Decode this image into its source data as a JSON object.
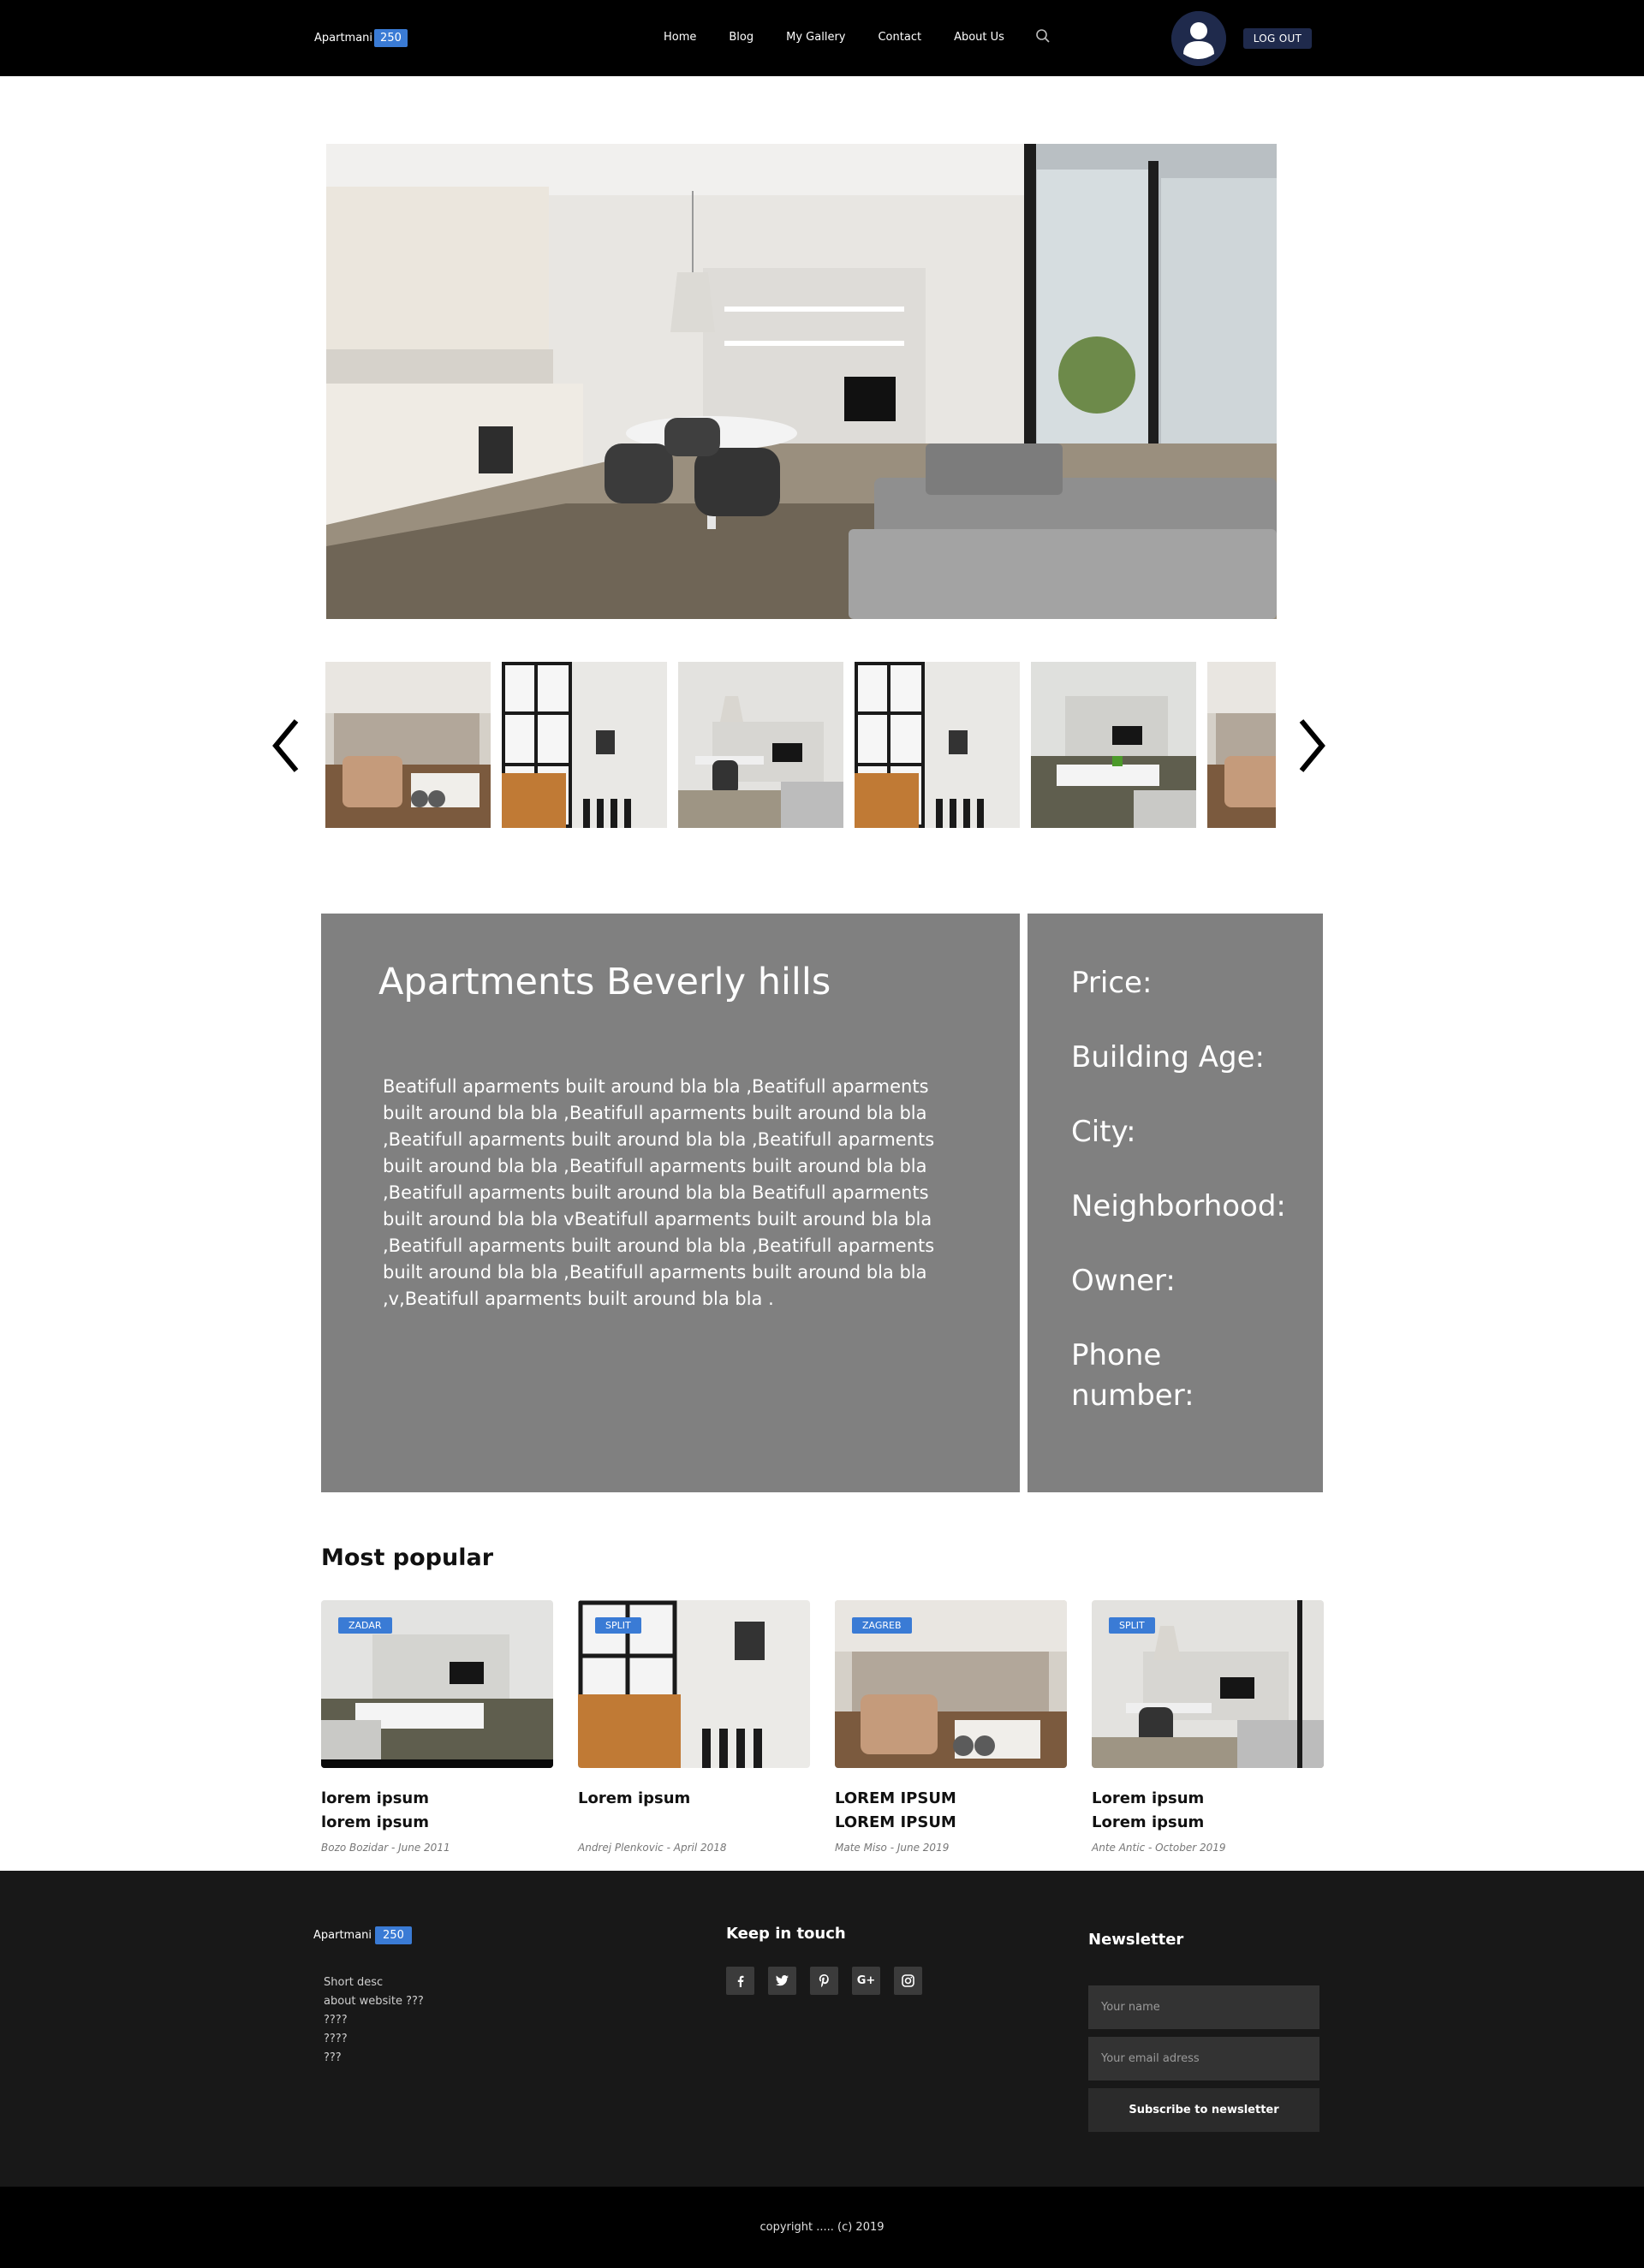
{
  "header": {
    "brand_name": "Apartmani",
    "brand_badge": "250",
    "nav": [
      "Home",
      "Blog",
      "My Gallery",
      "Contact",
      "About Us"
    ],
    "search_icon": "search-icon",
    "avatar_icon": "user-avatar-icon",
    "logout_label": "LOG OUT",
    "accent_color": "#3a7bd5",
    "navy_color": "#1f2a4c"
  },
  "gallery": {
    "prev_icon": "chevron-left-icon",
    "next_icon": "chevron-right-icon",
    "thumbnail_count": 6
  },
  "listing": {
    "title": "Apartments Beverly hills",
    "description": "Beatifull aparments built around bla bla ,Beatifull aparments built around bla bla ,Beatifull aparments built around bla bla ,Beatifull aparments built around bla bla ,Beatifull aparments built around bla bla ,Beatifull aparments built around bla bla ,Beatifull aparments built around bla bla Beatifull aparments built around bla bla vBeatifull aparments built around bla bla ,Beatifull aparments built around bla bla ,Beatifull aparments built around bla bla ,Beatifull aparments built around bla bla ,v,Beatifull aparments built around bla bla .",
    "specs": [
      "Price:",
      "Building Age:",
      "City:",
      "Neighborhood:",
      "Owner:",
      "Phone number:"
    ],
    "panel_color": "#808080"
  },
  "popular": {
    "heading": "Most popular",
    "cards": [
      {
        "badge": "ZADAR",
        "title_line1": "lorem ipsum",
        "title_line2": "lorem ipsum",
        "meta": "Bozo Bozidar - June 2011"
      },
      {
        "badge": "SPLIT",
        "title_line1": "Lorem ipsum",
        "title_line2": "",
        "meta": "Andrej Plenkovic - April 2018"
      },
      {
        "badge": "ZAGREB",
        "title_line1": "LOREM IPSUM",
        "title_line2": "LOREM IPSUM",
        "meta": "Mate Miso - June 2019"
      },
      {
        "badge": "SPLIT",
        "title_line1": "Lorem ipsum",
        "title_line2": "Lorem ipsum",
        "meta": "Ante Antic -  October 2019"
      }
    ]
  },
  "footer": {
    "brand_name": "Apartmani",
    "brand_badge": "250",
    "desc_lines": [
      "Short desc",
      "about website ???",
      "????",
      "????",
      "???"
    ],
    "keep_in_touch": "Keep in touch",
    "socials": [
      "facebook-icon",
      "twitter-icon",
      "pinterest-icon",
      "google-plus-icon",
      "instagram-icon"
    ],
    "newsletter_title": "Newsletter",
    "name_placeholder": "Your name",
    "email_placeholder": "Your email adress",
    "subscribe_label": "Subscribe to newsletter",
    "copyright": "copyright ..... (c) 2019"
  }
}
